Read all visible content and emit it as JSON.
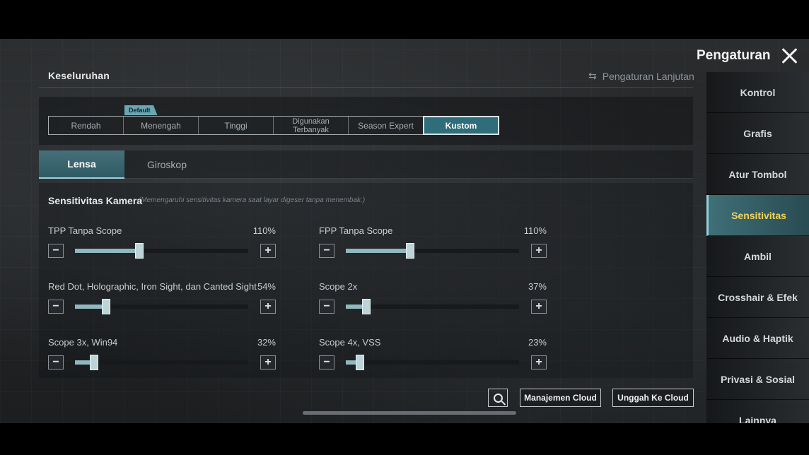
{
  "header": {
    "section_title": "Keseluruhan",
    "advanced_label": "Pengaturan Lanjutan",
    "settings_title": "Pengaturan"
  },
  "presets": {
    "default_badge": "Default",
    "items": [
      {
        "label": "Rendah",
        "active": false
      },
      {
        "label": "Menengah",
        "active": false
      },
      {
        "label": "Tinggi",
        "active": false
      },
      {
        "label": "Digunakan Terbanyak",
        "active": false
      },
      {
        "label": "Season Expert",
        "active": false
      },
      {
        "label": "Kustom",
        "active": true
      }
    ]
  },
  "tabs": [
    {
      "label": "Lensa",
      "active": true
    },
    {
      "label": "Giroskop",
      "active": false
    }
  ],
  "camera": {
    "title": "Sensitivitas Kamera",
    "description": "(Memengaruhi sensitivitas kamera saat layar digeser tanpa menembak.)",
    "sliders": [
      {
        "label": "TPP Tanpa Scope",
        "value": "110%",
        "level": 0.37
      },
      {
        "label": "FPP Tanpa Scope",
        "value": "110%",
        "level": 0.37
      },
      {
        "label": "Red Dot, Holographic, Iron Sight, dan Canted Sight",
        "value": "54%",
        "level": 0.18
      },
      {
        "label": "Scope 2x",
        "value": "37%",
        "level": 0.12
      },
      {
        "label": "Scope 3x, Win94",
        "value": "32%",
        "level": 0.11
      },
      {
        "label": "Scope 4x, VSS",
        "value": "23%",
        "level": 0.08
      }
    ]
  },
  "buttons": {
    "minus": "−",
    "plus": "+",
    "cloud_manage": "Manajemen Cloud",
    "cloud_upload": "Unggah Ke Cloud"
  },
  "sidebar": {
    "items": [
      {
        "label": "Kontrol",
        "active": false
      },
      {
        "label": "Grafis",
        "active": false
      },
      {
        "label": "Atur Tombol",
        "active": false
      },
      {
        "label": "Sensitivitas",
        "active": true
      },
      {
        "label": "Ambil",
        "active": false
      },
      {
        "label": "Crosshair & Efek",
        "active": false
      },
      {
        "label": "Audio & Haptik",
        "active": false
      },
      {
        "label": "Privasi & Sosial",
        "active": false
      },
      {
        "label": "Lainnya",
        "active": false
      }
    ]
  },
  "colors": {
    "accent": "#2f6d7a",
    "active_sidebar_text": "#f3d35a",
    "slider_fill": "#8fb8c0"
  },
  "icons": {
    "close": "close-icon",
    "advanced": "swap-icon",
    "search": "search-icon"
  }
}
